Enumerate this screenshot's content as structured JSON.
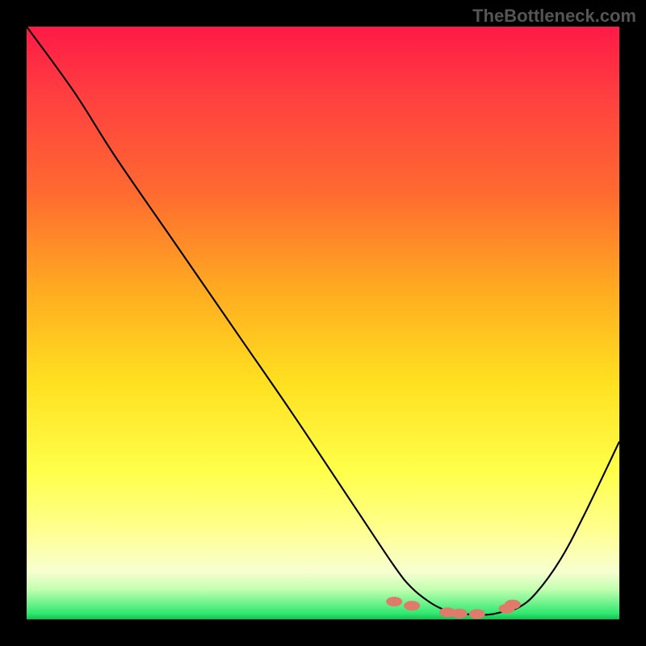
{
  "watermark": "TheBottleneck.com",
  "chart_data": {
    "type": "line",
    "title": "",
    "xlabel": "",
    "ylabel": "",
    "xlim": [
      0,
      100
    ],
    "ylim": [
      0,
      100
    ],
    "series": [
      {
        "name": "curve",
        "x": [
          0,
          8,
          15,
          25,
          35,
          45,
          55,
          62,
          65,
          68,
          70,
          72,
          75,
          78,
          80,
          83,
          86,
          90,
          94,
          100
        ],
        "y": [
          100,
          89,
          78,
          63.5,
          49,
          34.5,
          19.5,
          9,
          5.3,
          2.9,
          1.8,
          1.2,
          0.8,
          0.8,
          1.2,
          2.0,
          4.5,
          10,
          17.5,
          30
        ]
      }
    ],
    "markers": {
      "color": "#e07a6a",
      "x": [
        62,
        65,
        71,
        73,
        76,
        81,
        82
      ],
      "y": [
        3.0,
        2.3,
        1.2,
        1.0,
        0.9,
        1.8,
        2.5
      ]
    },
    "gradient_stops": [
      {
        "pos": 0,
        "color": "#ff1a47"
      },
      {
        "pos": 28,
        "color": "#ff6a30"
      },
      {
        "pos": 60,
        "color": "#ffe020"
      },
      {
        "pos": 85,
        "color": "#ffff90"
      },
      {
        "pos": 99,
        "color": "#30e870"
      },
      {
        "pos": 100,
        "color": "#10c050"
      }
    ]
  }
}
